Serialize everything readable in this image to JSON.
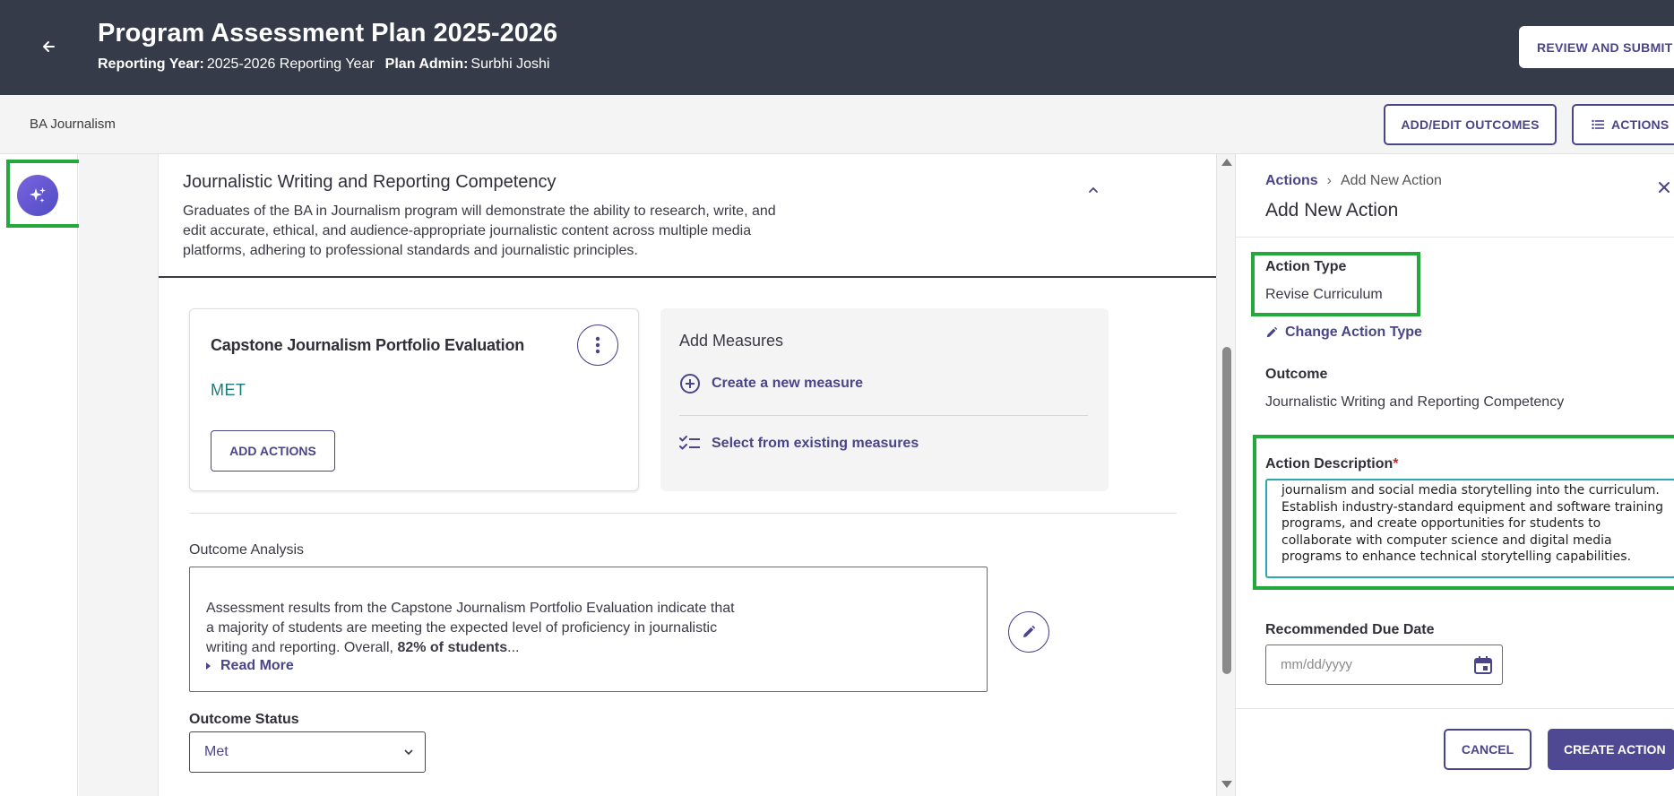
{
  "header": {
    "title": "Program Assessment Plan 2025-2026",
    "reporting_year_label": "Reporting Year:",
    "reporting_year_value": "2025-2026 Reporting Year",
    "plan_admin_label": "Plan Admin:",
    "plan_admin_value": "Surbhi Joshi",
    "review_submit_label": "REVIEW AND SUBMIT"
  },
  "subbar": {
    "program": "BA Journalism",
    "add_edit_outcomes_label": "ADD/EDIT OUTCOMES",
    "actions_label": "ACTIONS"
  },
  "outcome": {
    "title": "Journalistic Writing and Reporting Competency",
    "description": "Graduates of the BA in Journalism program will demonstrate the ability to research, write, and edit accurate, ethical, and audience-appropriate journalistic content across multiple media platforms, adhering to professional standards and journalistic principles."
  },
  "measure": {
    "title": "Capstone Journalism Portfolio Evaluation",
    "status": "MET",
    "add_actions_label": "ADD ACTIONS"
  },
  "add_measures": {
    "title": "Add Measures",
    "create_label": "Create a new measure",
    "select_label": "Select from existing measures"
  },
  "analysis": {
    "label": "Outcome Analysis",
    "text_before": "Assessment results from the Capstone Journalism Portfolio Evaluation indicate that a majority of students are meeting the expected level of proficiency in journalistic writing and reporting. Overall, ",
    "text_bold": "82% of students",
    "text_after": "...",
    "read_more": "Read More"
  },
  "status": {
    "label": "Outcome Status",
    "selected": "Met"
  },
  "drawer": {
    "crumb_link": "Actions",
    "crumb_sep": "›",
    "crumb_current": "Add New Action",
    "title": "Add New Action",
    "action_type_label": "Action Type",
    "action_type_value": "Revise Curriculum",
    "change_type_label": "Change Action Type",
    "outcome_label": "Outcome",
    "outcome_value": "Journalistic Writing and Reporting Competency",
    "description_label": "Action Description",
    "required_mark": "*",
    "description_text": "journalism and social media storytelling into the curriculum. Establish industry-standard equipment and software training programs, and create opportunities for students to collaborate with computer science and digital media programs to enhance technical storytelling capabilities.",
    "due_date_label": "Recommended Due Date",
    "due_date_placeholder": "mm/dd/yyyy",
    "cancel_label": "CANCEL",
    "create_label": "CREATE ACTION"
  },
  "icons": {
    "back": "arrow-left-icon",
    "ai": "sparkle-icon",
    "collapse": "chevron-up-icon",
    "kebab": "more-vertical-icon",
    "plus": "plus-circle-icon",
    "checklist": "checklist-icon",
    "edit": "pencil-icon",
    "close": "close-icon",
    "calendar": "calendar-icon"
  },
  "colors": {
    "header_bg": "#353b48",
    "accent": "#4a4489",
    "met": "#1a7d7d",
    "highlight": "#22a83b",
    "focus": "#2aa7b0"
  }
}
